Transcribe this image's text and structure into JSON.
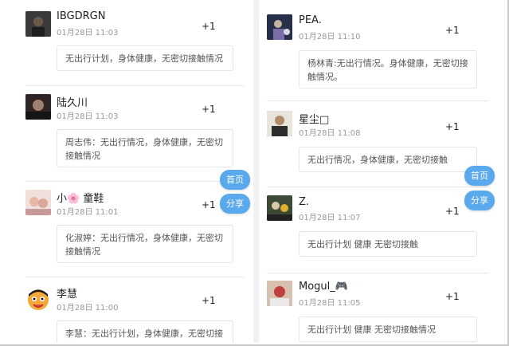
{
  "left_column": [
    {
      "name": "IBGDRGN",
      "time": "01月28日 11:03",
      "plus": "+1",
      "content": "无出行计划，身体健康，无密切接触情况"
    },
    {
      "name": "陆久川",
      "time": "01月28日 11:03",
      "plus": "+1",
      "content": "周志伟：无出行情况，身体健康，无密切接触情况"
    },
    {
      "name": "小🌸 童鞋",
      "time": "01月28日 11:01",
      "plus": "+1",
      "content": "化淑婷：无出行情况，身体健康，无密切接触情况"
    },
    {
      "name": "李慧",
      "time": "01月28日 11:00",
      "plus": "+1",
      "content": "李慧：无出行计划，身体健康，无密切接触"
    }
  ],
  "right_column": [
    {
      "name": "PEA.",
      "time": "01月28日 11:10",
      "plus": "+1",
      "content": "杨林青:无出行情况。身体健康，无密切接触情况。"
    },
    {
      "name": "星尘□",
      "time": "01月28日 11:08",
      "plus": "+1",
      "content": "无出行情况，身体健康，无密切接触"
    },
    {
      "name": "Z.",
      "time": "01月28日 11:07",
      "plus": "+1",
      "content": "无出行计划 健康 无密切接触"
    },
    {
      "name": "Mogul_🎮",
      "time": "01月28日 11:05",
      "plus": "+1",
      "content": "无出行计划 健康 无密切接触情况"
    }
  ],
  "buttons": {
    "home": "首页",
    "share": "分享"
  },
  "colors": {
    "button": "#5aa9ec",
    "separator": "#e6e6e6"
  }
}
